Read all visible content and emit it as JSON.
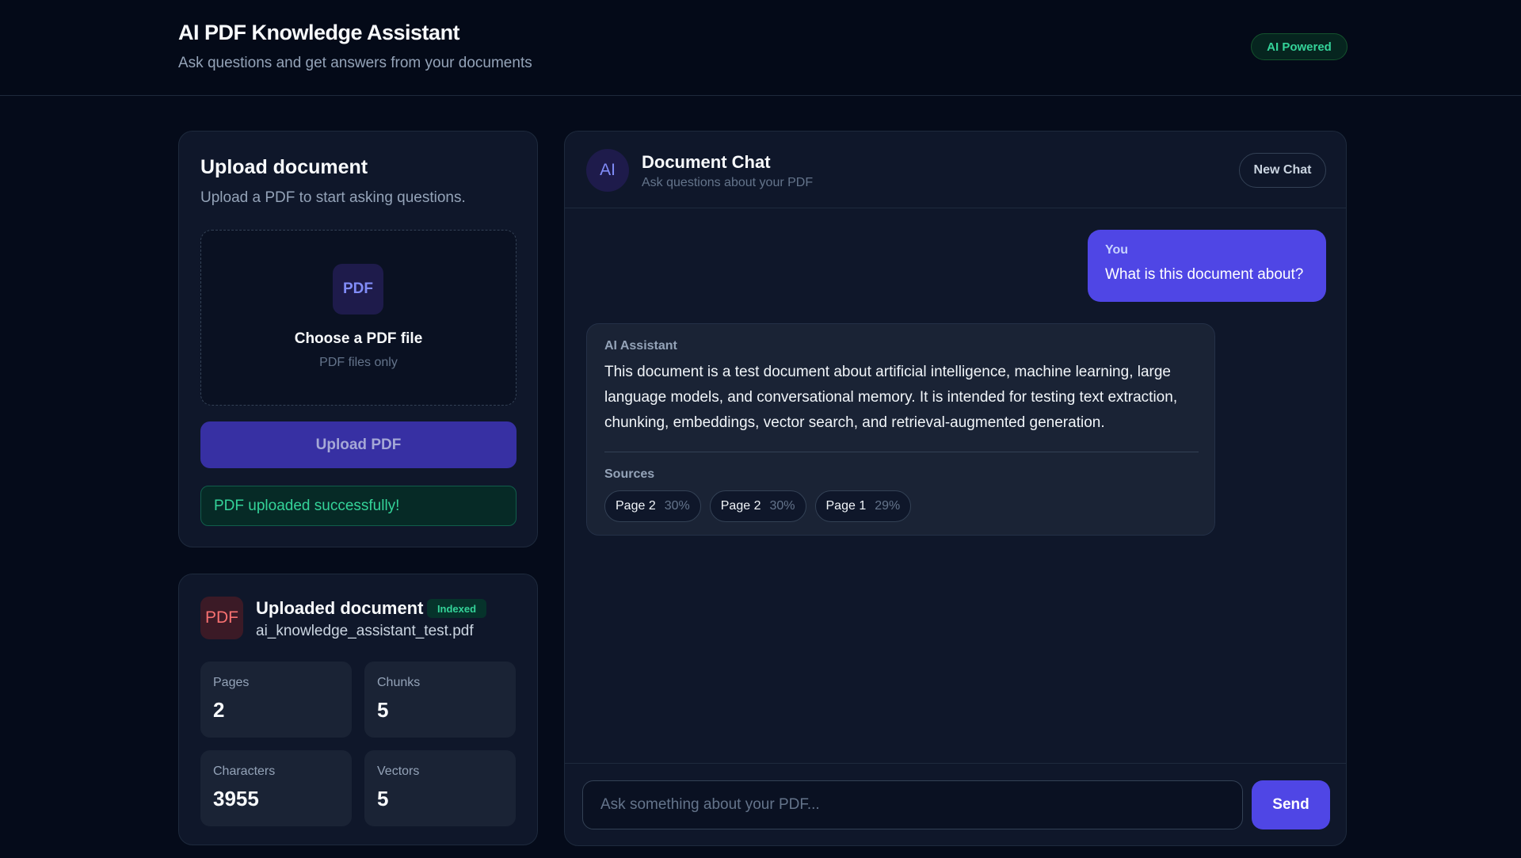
{
  "header": {
    "title": "AI PDF Knowledge Assistant",
    "subtitle": "Ask questions and get answers from your documents",
    "badge": "AI Powered"
  },
  "upload": {
    "title": "Upload document",
    "subtitle": "Upload a PDF to start asking questions.",
    "icon_text": "PDF",
    "choose_label": "Choose a PDF file",
    "choose_hint": "PDF files only",
    "button_label": "Upload PDF",
    "status_message": "PDF uploaded successfully!"
  },
  "document": {
    "icon_text": "PDF",
    "title": "Uploaded document",
    "badge": "Indexed",
    "filename": "ai_knowledge_assistant_test.pdf",
    "stats": [
      {
        "label": "Pages",
        "value": "2"
      },
      {
        "label": "Chunks",
        "value": "5"
      },
      {
        "label": "Characters",
        "value": "3955"
      },
      {
        "label": "Vectors",
        "value": "5"
      }
    ]
  },
  "chat": {
    "avatar_text": "AI",
    "title": "Document Chat",
    "subtitle": "Ask questions about your PDF",
    "new_chat_label": "New Chat",
    "messages": [
      {
        "sender": "You",
        "text": "What is this document about?"
      },
      {
        "sender": "AI Assistant",
        "text": "This document is a test document about artificial intelligence, machine learning, large language models, and conversational memory. It is intended for testing text extraction, chunking, embeddings, vector search, and retrieval-augmented generation.",
        "sources_label": "Sources",
        "sources": [
          {
            "page": "Page 2",
            "score": "30%"
          },
          {
            "page": "Page 2",
            "score": "30%"
          },
          {
            "page": "Page 1",
            "score": "29%"
          }
        ]
      }
    ],
    "input_placeholder": "Ask something about your PDF...",
    "input_value": "",
    "send_label": "Send"
  },
  "colors": {
    "background": "#050b1a",
    "card": "#0f172a",
    "accent": "#4f46e5",
    "success": "#34d399",
    "danger": "#f87171"
  }
}
